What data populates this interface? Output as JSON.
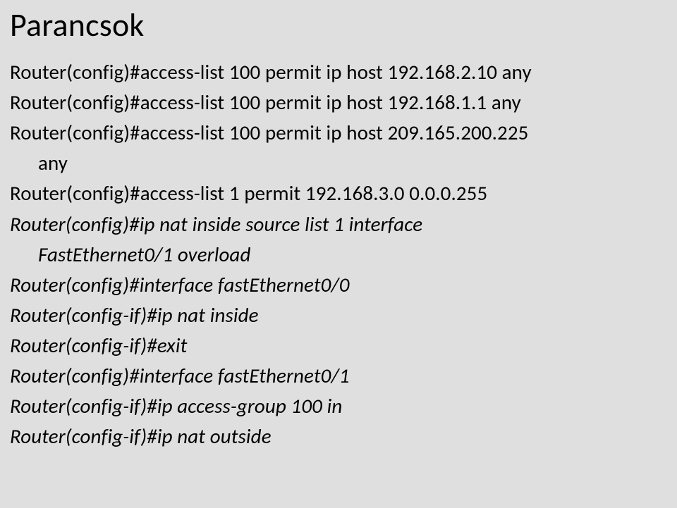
{
  "title": "Parancsok",
  "lines": [
    {
      "text": "Router(config)#access-list 100 permit ip host 192.168.2.10 any",
      "italic": false,
      "indent": false
    },
    {
      "text": "Router(config)#access-list 100 permit ip host 192.168.1.1 any",
      "italic": false,
      "indent": false
    },
    {
      "text": "Router(config)#access-list 100 permit ip host 209.165.200.225",
      "italic": false,
      "indent": false
    },
    {
      "text": "any",
      "italic": false,
      "indent": true
    },
    {
      "text": "Router(config)#access-list 1 permit 192.168.3.0 0.0.0.255",
      "italic": false,
      "indent": false
    },
    {
      "text": "Router(config)#ip nat inside source list 1 interface",
      "italic": true,
      "indent": false
    },
    {
      "text": "FastEthernet0/1 overload",
      "italic": true,
      "indent": true
    },
    {
      "text": "Router(config)#interface fastEthernet0/0",
      "italic": true,
      "indent": false
    },
    {
      "text": "Router(config-if)#ip nat inside",
      "italic": true,
      "indent": false
    },
    {
      "text": "Router(config-if)#exit",
      "italic": true,
      "indent": false
    },
    {
      "text": "Router(config)#interface fastEthernet0/1",
      "italic": true,
      "indent": false
    },
    {
      "text": "Router(config-if)#ip access-group 100 in",
      "italic": true,
      "indent": false
    },
    {
      "text": "Router(config-if)#ip nat outside",
      "italic": true,
      "indent": false
    }
  ]
}
